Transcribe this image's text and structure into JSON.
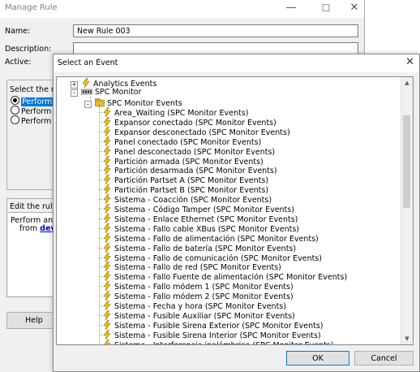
{
  "manage_rule": {
    "title": "Manage Rule",
    "name_label": "Name:",
    "name_value": "New Rule 003",
    "description_label": "Description:",
    "active_label": "Active:",
    "select_rule_label": "Select the rul",
    "radio_options": [
      "Perform a",
      "Perform a",
      "Perform a"
    ],
    "edit_label": "Edit the rule d",
    "desc_text_1": "Perform an ac",
    "desc_text_2_prefix": "from ",
    "desc_link": "devi",
    "help_button": "Help"
  },
  "dialog": {
    "title": "Select an Event",
    "ok_button": "OK",
    "cancel_button": "Cancel",
    "tree": {
      "root_1": "Analytics Events",
      "root_2": "SPC Monitor",
      "folder": "SPC Monitor Events",
      "events": [
        "Area_Waiting (SPC Monitor Events)",
        "Expansor conectado (SPC Monitor Events)",
        "Expansor desconectado (SPC Monitor Events)",
        "Panel conectado (SPC Monitor Events)",
        "Panel desconectado (SPC Monitor Events)",
        "Partición armada (SPC Monitor Events)",
        "Partición desarmada (SPC Monitor Events)",
        "Partición Partset A (SPC Monitor Events)",
        "Partición Partset B (SPC Monitor Events)",
        "Sistema - Coacción (SPC Monitor Events)",
        "Sistema - Código Tamper (SPC Monitor Events)",
        "Sistema - Enlace Ethernet  (SPC Monitor Events)",
        "Sistema - Fallo cable XBus (SPC Monitor Events)",
        "Sistema - Fallo de alimentación (SPC Monitor Events)",
        "Sistema - Fallo de batería (SPC Monitor Events)",
        "Sistema - Fallo de comunicación (SPC Monitor Events)",
        "Sistema - Fallo de red (SPC Monitor Events)",
        "Sistema - Fallo Fuente de alimentación  (SPC Monitor Events)",
        "Sistema - Fallo módem 1 (SPC Monitor Events)",
        "Sistema - Fallo módem 2 (SPC Monitor Events)",
        "Sistema - Fecha y hora (SPC Monitor Events)",
        "Sistema - Fusible Auxiliar (SPC Monitor Events)",
        "Sistema - Fusible Sirena Exterior (SPC Monitor Events)",
        "Sistema - Fusible Sirena Interior (SPC Monitor Events)",
        "Sistema - Interferencia inalámbrica (SPC Monitor Events)"
      ]
    }
  },
  "icons": [
    "minimize-icon",
    "maximize-icon",
    "close-icon",
    "event-lightning-icon",
    "spc-device-icon",
    "folder-events-icon",
    "expand-icon",
    "collapse-icon"
  ],
  "colors": {
    "selection": "#0078d7",
    "event_icon": "#f5c400",
    "link": "#0000cc"
  }
}
